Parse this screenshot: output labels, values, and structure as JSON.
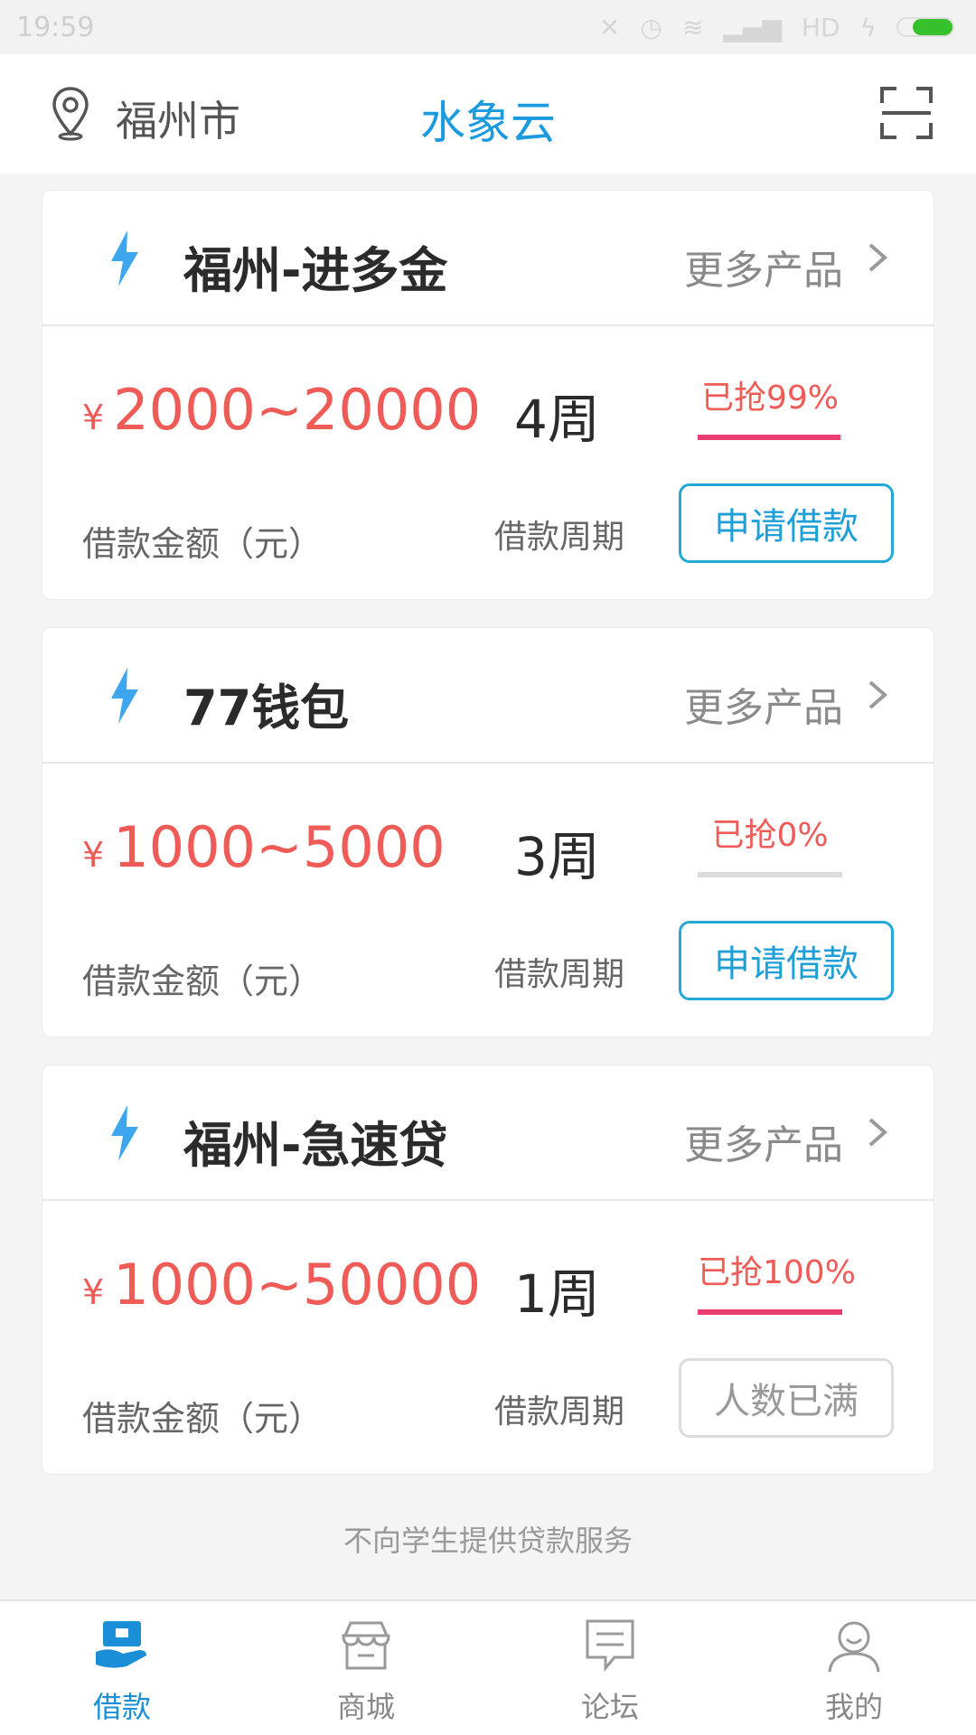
{
  "status": {
    "time": "19:59",
    "network": "HD"
  },
  "header": {
    "city": "福州市",
    "title": "水象云"
  },
  "cards": [
    {
      "name": "福州-进多金",
      "more": "更多产品",
      "currency": "¥",
      "amount": "2000~20000",
      "period": "4周",
      "grab_text": "已抢99%",
      "grab_fraction": 0.99,
      "amount_label": "借款金额（元）",
      "period_label": "借款周期",
      "button": "申请借款",
      "button_state": "active"
    },
    {
      "name": "77钱包",
      "more": "更多产品",
      "currency": "¥",
      "amount": "1000~5000",
      "period": "3周",
      "grab_text": "已抢0%",
      "grab_fraction": 0.0,
      "amount_label": "借款金额（元）",
      "period_label": "借款周期",
      "button": "申请借款",
      "button_state": "active"
    },
    {
      "name": "福州-急速贷",
      "more": "更多产品",
      "currency": "¥",
      "amount": "1000~50000",
      "period": "1周",
      "grab_text": "已抢100%",
      "grab_fraction": 1.0,
      "amount_label": "借款金额（元）",
      "period_label": "借款周期",
      "button": "人数已满",
      "button_state": "full"
    }
  ],
  "notice": "不向学生提供贷款服务",
  "nav": [
    {
      "label": "借款",
      "icon": "loan-icon",
      "active": true
    },
    {
      "label": "商城",
      "icon": "shop-icon",
      "active": false
    },
    {
      "label": "论坛",
      "icon": "forum-icon",
      "active": false
    },
    {
      "label": "我的",
      "icon": "profile-icon",
      "active": false
    }
  ],
  "colors": {
    "accent": "#1a9be0",
    "price": "#ef5b56",
    "progress": "#ea3f70",
    "button_border": "#23a8d8"
  }
}
